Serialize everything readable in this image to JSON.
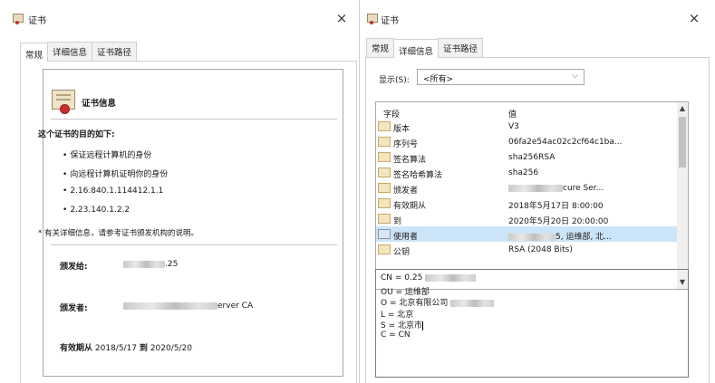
{
  "window1": {
    "title": "证书",
    "close_glyph": "×",
    "tabs": [
      "常规",
      "详细信息",
      "证书路径"
    ],
    "general": {
      "info_title": "证书信息",
      "purpose_title": "这个证书的目的如下:",
      "purposes": [
        "保证远程计算机的身份",
        "向远程计算机证明你的身份",
        "2.16.840.1.114412.1.1",
        "2.23.140.1.2.2"
      ],
      "note": "* 有关详细信息，请参考证书颁发机构的说明。",
      "issued_to_label": "颁发给:",
      "issued_to_value": ".25",
      "issued_by_label": "颁发者:",
      "issued_by_value": "erver CA",
      "validity_from_label": "有效期从",
      "validity_from": "2018/5/17",
      "validity_to_label": "到",
      "validity_to": "2020/5/20"
    }
  },
  "window2": {
    "title": "证书",
    "close_glyph": "×",
    "tabs": [
      "常规",
      "详细信息",
      "证书路径"
    ],
    "details": {
      "show_label": "显示(S):",
      "show_selected": "<所有>",
      "columns": [
        "字段",
        "值"
      ],
      "rows": [
        {
          "field": "版本",
          "value": "V3"
        },
        {
          "field": "序列号",
          "value": "06fa2e54ac02c2cf64c1ba..."
        },
        {
          "field": "签名算法",
          "value": "sha256RSA"
        },
        {
          "field": "签名哈希算法",
          "value": "sha256"
        },
        {
          "field": "颁发者",
          "value": "cure Ser..."
        },
        {
          "field": "有效期从",
          "value": "2018年5月17日 8:00:00"
        },
        {
          "field": "到",
          "value": "2020年5月20日 20:00:00"
        },
        {
          "field": "使用者",
          "value": "5, 运维部, 北..."
        },
        {
          "field": "公钥",
          "value": "RSA (2048 Bits)"
        }
      ],
      "subject_lines": [
        "CN = 0.25",
        "OU = 运维部",
        "O = 北京有限公司",
        "L = 北京",
        "S = 北京市",
        "C = CN"
      ]
    }
  },
  "colors": {
    "selection": "#cce4f7",
    "border": "#a9a9a9",
    "window_bg": "#ffffff"
  }
}
